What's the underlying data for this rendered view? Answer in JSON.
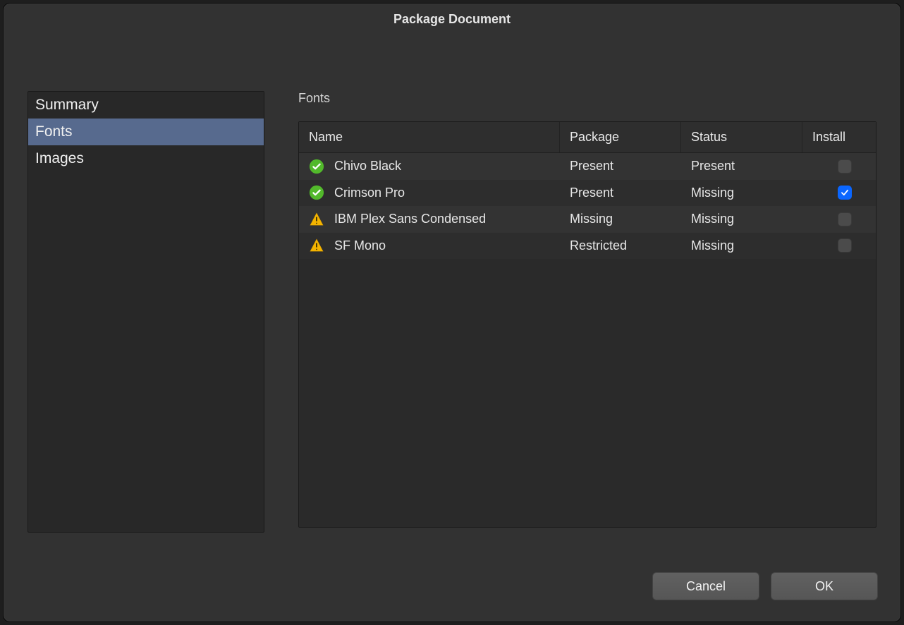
{
  "dialog": {
    "title": "Package Document"
  },
  "sidebar": {
    "items": [
      {
        "label": "Summary",
        "selected": false
      },
      {
        "label": "Fonts",
        "selected": true
      },
      {
        "label": "Images",
        "selected": false
      }
    ]
  },
  "main": {
    "section_label": "Fonts",
    "table": {
      "columns": {
        "name": "Name",
        "package": "Package",
        "status": "Status",
        "install": "Install"
      },
      "rows": [
        {
          "icon": "ok",
          "name": "Chivo Black",
          "package": "Present",
          "status": "Present",
          "install_checked": false
        },
        {
          "icon": "ok",
          "name": "Crimson Pro",
          "package": "Present",
          "status": "Missing",
          "install_checked": true
        },
        {
          "icon": "warn",
          "name": "IBM Plex Sans Condensed",
          "package": "Missing",
          "status": "Missing",
          "install_checked": false
        },
        {
          "icon": "warn",
          "name": "SF Mono",
          "package": "Restricted",
          "status": "Missing",
          "install_checked": false
        }
      ]
    }
  },
  "footer": {
    "cancel_label": "Cancel",
    "ok_label": "OK"
  }
}
